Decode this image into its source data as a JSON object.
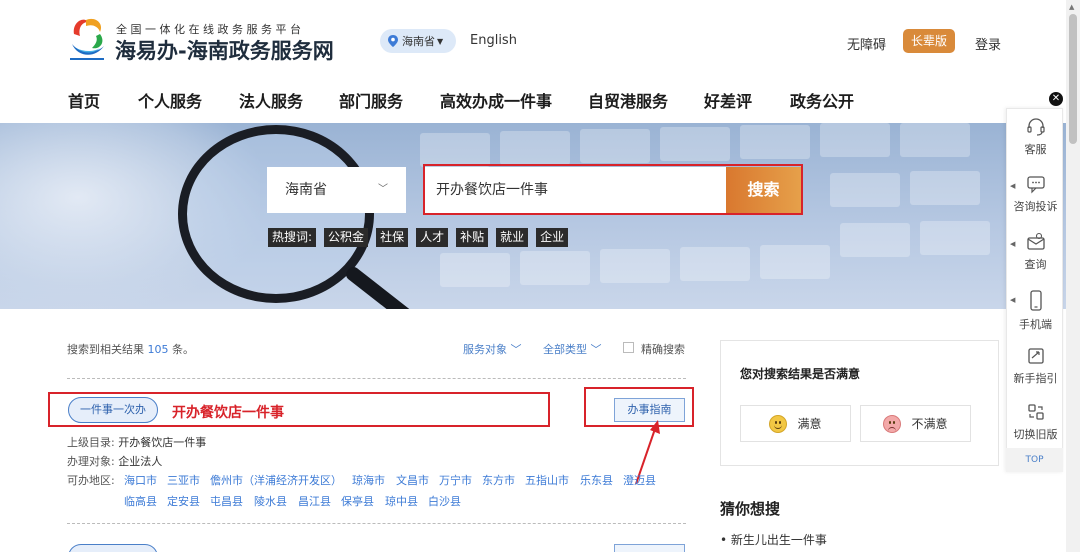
{
  "header": {
    "tagline": "全国一体化在线政务服务平台",
    "title": "海易办-海南政务服务网",
    "region_pill": "海南省",
    "english": "English",
    "accessibility": "无障碍",
    "elder_mode": "长辈版",
    "login": "登录"
  },
  "nav": {
    "items": [
      "首页",
      "个人服务",
      "法人服务",
      "部门服务",
      "高效办成一件事",
      "自贸港服务",
      "好差评",
      "政务公开"
    ]
  },
  "search": {
    "region": "海南省",
    "query": "开办餐饮店一件事",
    "button": "搜索",
    "hot_label": "热搜词:",
    "hot_words": [
      "公积金",
      "社保",
      "人才",
      "补贴",
      "就业",
      "企业"
    ]
  },
  "results": {
    "count_prefix": "搜索到相关结果",
    "count": "105",
    "count_suffix": "条。",
    "filters": [
      "服务对象",
      "全部类型"
    ],
    "exact_label": "精确搜索",
    "item1": {
      "tag": "一件事一次办",
      "title": "开办餐饮店一件事",
      "guide": "办事指南",
      "parent_label": "上级目录:",
      "parent_value": "开办餐饮店一件事",
      "target_label": "办理对象:",
      "target_value": "企业法人",
      "area_label": "可办地区:",
      "areas_row1": [
        "海口市",
        "三亚市",
        "儋州市（洋浦经济开发区）",
        "琼海市",
        "文昌市",
        "万宁市",
        "东方市",
        "五指山市",
        "乐东县",
        "澄迈县"
      ],
      "areas_row2": [
        "临高县",
        "定安县",
        "屯昌县",
        "陵水县",
        "昌江县",
        "保亭县",
        "琼中县",
        "白沙县"
      ]
    }
  },
  "satisfaction": {
    "title": "您对搜索结果是否满意",
    "satisfied": "满意",
    "unsatisfied": "不满意"
  },
  "guess": {
    "title": "猜你想搜",
    "items": [
      "新生儿出生一件事"
    ]
  },
  "float_bar": {
    "items": [
      "客服",
      "咨询投诉",
      "查询",
      "手机端",
      "新手指引",
      "切换旧版"
    ],
    "top": "TOP"
  },
  "colors": {
    "highlight": "#d8232a",
    "link": "#3d7bd6",
    "search_button": "#d9782f"
  }
}
